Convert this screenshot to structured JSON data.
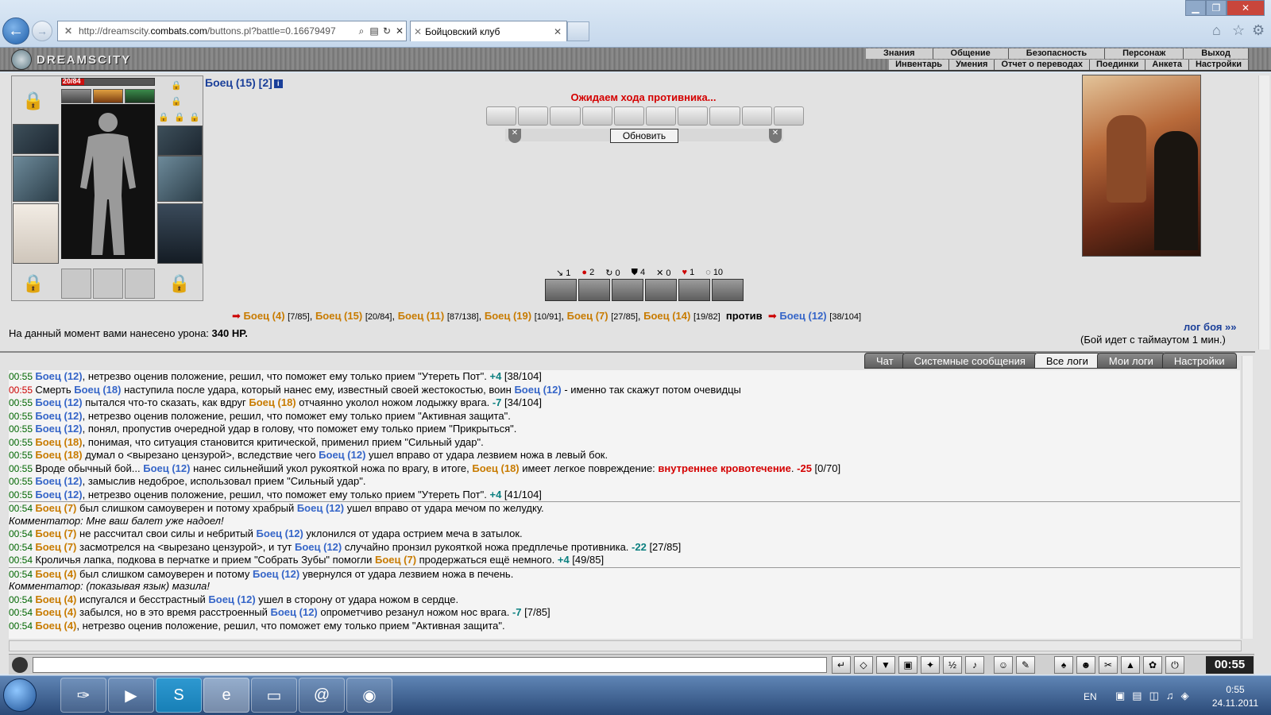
{
  "browser": {
    "url_prefix": "http://dreamscity.",
    "url_domain": "combats.com",
    "url_suffix": "/buttons.pl?battle=0.16679497",
    "tab_title": "Бойцовский клуб"
  },
  "site": {
    "logo": "DREAMSCITY",
    "menu_top": [
      "Знания",
      "Общение",
      "Безопасность",
      "Персонаж",
      "Выход"
    ],
    "menu_sub": [
      "Инвентарь",
      "Умения",
      "Отчет о переводах",
      "Поединки",
      "Анкета",
      "Настройки"
    ]
  },
  "character": {
    "hp": "20/84",
    "hp_fraction": 0.238,
    "name": "Боец (15) [2]",
    "info_icon": "i"
  },
  "battle": {
    "waiting": "Ожидаем хода противника...",
    "refresh": "Обновить",
    "stats": [
      "1",
      "2",
      "0",
      "4",
      "0",
      "1",
      "10"
    ],
    "team1": [
      {
        "n": "Боец (4)",
        "h": "[7/85]"
      },
      {
        "n": "Боец (15)",
        "h": "[20/84]"
      },
      {
        "n": "Боец (11)",
        "h": "[87/138]"
      },
      {
        "n": "Боец (19)",
        "h": "[10/91]"
      },
      {
        "n": "Боец (7)",
        "h": "[27/85]"
      },
      {
        "n": "Боец (14)",
        "h": "[19/82]"
      }
    ],
    "vs": "против",
    "team2": [
      {
        "n": "Боец (12)",
        "h": "[38/104]"
      }
    ],
    "log_link": "лог боя »»",
    "timeout": "(Бой идет с таймаутом 1 мин.)",
    "damage_label": "На данный момент вами нанесено урона:",
    "damage_value": "340 HP."
  },
  "log_tabs": [
    "Чат",
    "Системные сообщения",
    "Все логи",
    "Мои логи",
    "Настройки"
  ],
  "log_lines": [
    "00:55 Боец (12), нетрезво оценив положение, решил, что поможет ему только прием \"Утереть Пот\". +4 [38/104]",
    "00:55 Смерть Боец (18) наступила после удара, который нанес ему, известный своей жестокостью, воин Боец (12) - именно так скажут потом очевидцы",
    "00:55 Боец (12) пытался что-то сказать, как вдруг Боец (18) отчаянно уколол ножом лодыжку врага. -7 [34/104]",
    "00:55 Боец (12), нетрезво оценив положение, решил, что поможет ему только прием \"Активная защита\".",
    "00:55 Боец (12), понял, пропустив очередной удар в голову, что поможет ему только прием \"Прикрыться\".",
    "00:55 Боец (18), понимая, что ситуация становится критической, применил прием \"Сильный удар\".",
    "00:55 Боец (18) думал о <вырезано цензурой>, вследствие чего Боец (12) ушел вправо от удара лезвием ножа в левый бок.",
    "00:55 Вроде обычный бой... Боец (12) нанес сильнейший укол рукояткой ножа по врагу, в итоге, Боец (18) имеет легкое повреждение: внутреннее кровотечение. -25 [0/70]",
    "00:55 Боец (12), замыслив недоброе, использовал прием \"Сильный удар\".",
    "00:55 Боец (12), нетрезво оценив положение, решил, что поможет ему только прием \"Утереть Пот\". +4 [41/104]",
    "00:54 Боец (7) был слишком самоуверен и потому храбрый Боец (12) ушел вправо от удара мечом по желудку.",
    "Комментатор: Мне ваш балет уже надоел!",
    "00:54 Боец (7) не рассчитал свои силы и небритый Боец (12) уклонился от удара острием меча в затылок.",
    "00:54 Боец (7) засмотрелся на <вырезано цензурой>, и тут Боец (12) случайно пронзил рукояткой ножа предплечье противника. -22 [27/85]",
    "00:54 Кроличья лапка, подкова в перчатке и прием \"Собрать Зубы\" помогли Боец (7) продержаться ещё немного. +4 [49/85]",
    "00:54 Боец (4) был слишком самоуверен и потому Боец (12) увернулся от удара лезвием ножа в печень.",
    "Комментатор: (показывая язык) мазила!",
    "00:54 Боец (4) испугался и бесстрастный Боец (12) ушел в сторону от удара ножом в сердце.",
    "00:54 Боец (4) забылся, но в это время расстроенный Боец (12) опрометчиво резанул ножом нос врага. -7 [7/85]",
    "00:54 Боец (4), нетрезво оценив положение, решил, что поможет ему только прием \"Активная защита\"."
  ],
  "clock": "00:55",
  "taskbar": {
    "lang": "EN",
    "time": "0:55",
    "date": "24.11.2011"
  }
}
